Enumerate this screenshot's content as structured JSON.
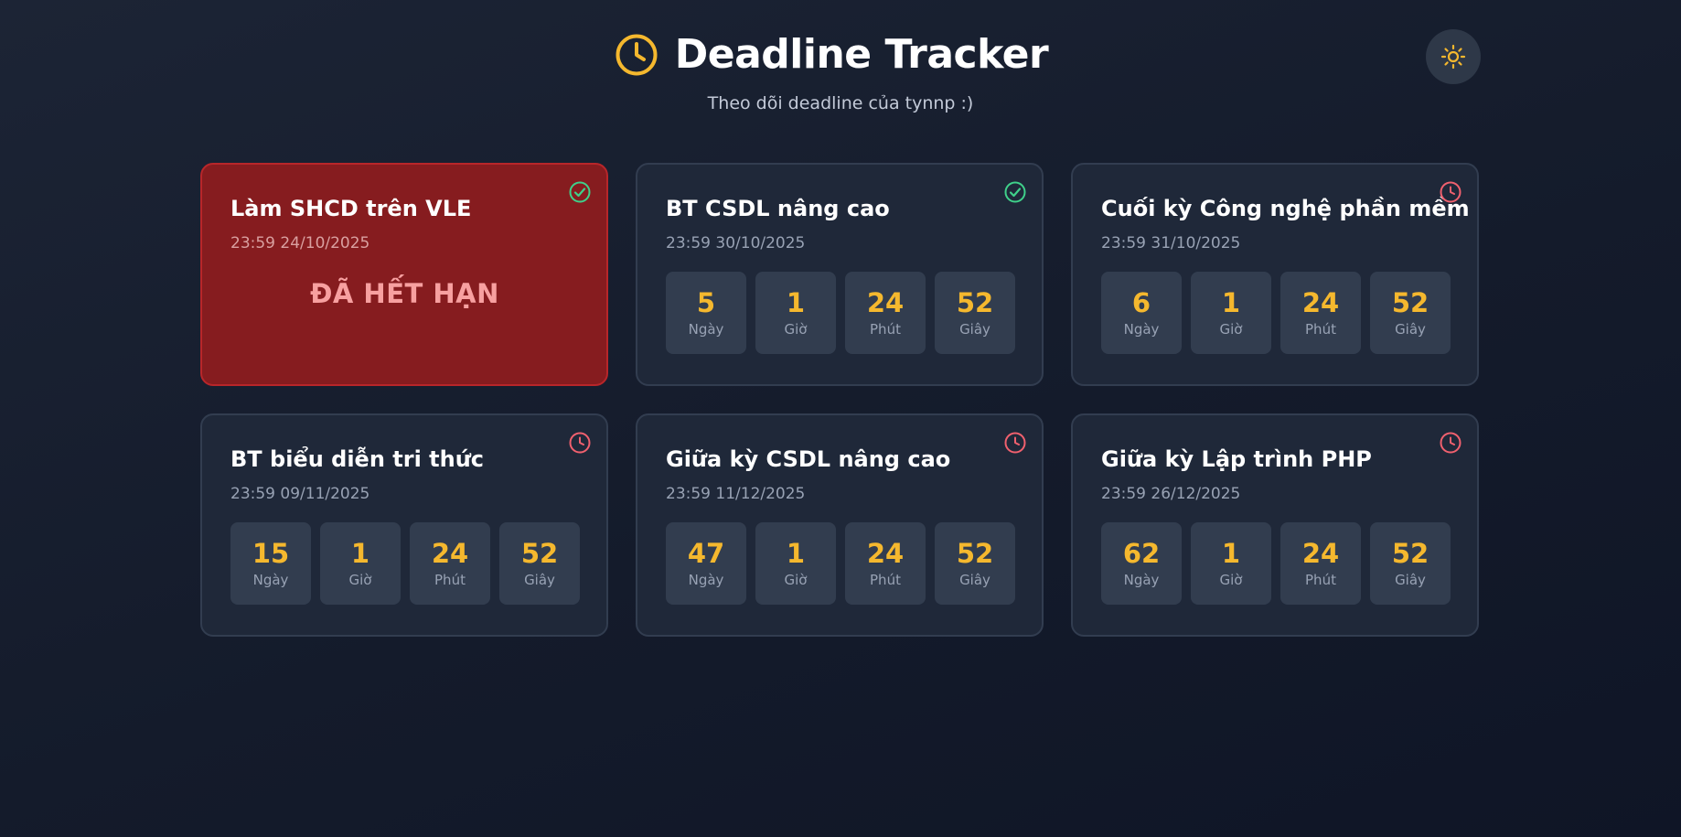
{
  "header": {
    "title": "Deadline Tracker",
    "subtitle": "Theo dõi deadline của tynnp :)",
    "logo_icon": "clock-icon",
    "theme_toggle_icon": "sun-icon"
  },
  "colors": {
    "accent": "#f5b82e",
    "expired_bg": "#861c1f",
    "done": "#3fd08a",
    "pending": "#f0606e"
  },
  "units": {
    "days": "Ngày",
    "hours": "Giờ",
    "minutes": "Phút",
    "seconds": "Giây"
  },
  "cards": [
    {
      "title": "Làm SHCD trên VLE",
      "date": "23:59 24/10/2025",
      "status": "done",
      "expired": true,
      "expired_label": "ĐÃ HẾT HẠN"
    },
    {
      "title": "BT CSDL nâng cao",
      "date": "23:59 30/10/2025",
      "status": "done",
      "expired": false,
      "days": "5",
      "hours": "1",
      "minutes": "24",
      "seconds": "52"
    },
    {
      "title": "Cuối kỳ Công nghệ phần mềm",
      "date": "23:59 31/10/2025",
      "status": "pending",
      "expired": false,
      "days": "6",
      "hours": "1",
      "minutes": "24",
      "seconds": "52"
    },
    {
      "title": "BT biểu diễn tri thức",
      "date": "23:59 09/11/2025",
      "status": "pending",
      "expired": false,
      "days": "15",
      "hours": "1",
      "minutes": "24",
      "seconds": "52"
    },
    {
      "title": "Giữa kỳ CSDL nâng cao",
      "date": "23:59 11/12/2025",
      "status": "pending",
      "expired": false,
      "days": "47",
      "hours": "1",
      "minutes": "24",
      "seconds": "52"
    },
    {
      "title": "Giữa kỳ Lập trình PHP",
      "date": "23:59 26/12/2025",
      "status": "pending",
      "expired": false,
      "days": "62",
      "hours": "1",
      "minutes": "24",
      "seconds": "52"
    }
  ]
}
